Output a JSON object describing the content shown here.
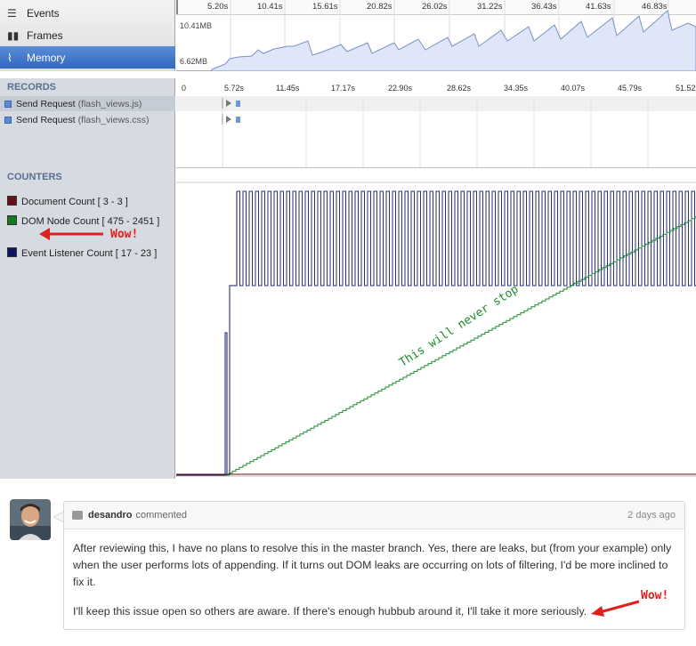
{
  "nav": {
    "items": [
      {
        "label": "Events",
        "icon": "events-icon"
      },
      {
        "label": "Frames",
        "icon": "frames-icon"
      },
      {
        "label": "Memory",
        "icon": "memory-icon",
        "selected": true
      }
    ]
  },
  "overview": {
    "ticks": [
      "5.20s",
      "10.41s",
      "15.61s",
      "20.82s",
      "26.02s",
      "31.22s",
      "36.43s",
      "41.63s",
      "46.83s"
    ],
    "memory_max": "10.41MB",
    "memory_min": "6.62MB"
  },
  "records": {
    "title": "RECORDS",
    "ticks": [
      "0",
      "5.72s",
      "11.45s",
      "17.17s",
      "22.90s",
      "28.62s",
      "34.35s",
      "40.07s",
      "45.79s",
      "51.52"
    ],
    "rows": [
      {
        "label": "Send Request",
        "detail": "(flash_views.js)"
      },
      {
        "label": "Send Request",
        "detail": "(flash_views.css)"
      }
    ]
  },
  "counters": {
    "title": "COUNTERS",
    "items": [
      {
        "label": "Document Count [ 3 - 3 ]",
        "color": "#6b0f16"
      },
      {
        "label": "DOM Node Count [ 475 - 2451 ]",
        "color": "#137a21"
      },
      {
        "label": "Event Listener Count [ 17 - 23 ]",
        "color": "#101560"
      }
    ],
    "annotation_wow": "Wow!",
    "annotation_never": "This will never stop"
  },
  "comment": {
    "author": "desandro",
    "action": "commented",
    "time": "2 days ago",
    "paragraph1": "After reviewing this, I have no plans to resolve this in the master branch. Yes, there are leaks, but (from your example) only when the user performs lots of appending. If it turns out DOM leaks are occurring on lots of filtering, I'd be more inclined to fix it.",
    "paragraph2": "I'll keep this issue open so others are aware. If there's enough hubbub around it, I'll take it more seriously.",
    "annotation_wow": "Wow!"
  }
}
